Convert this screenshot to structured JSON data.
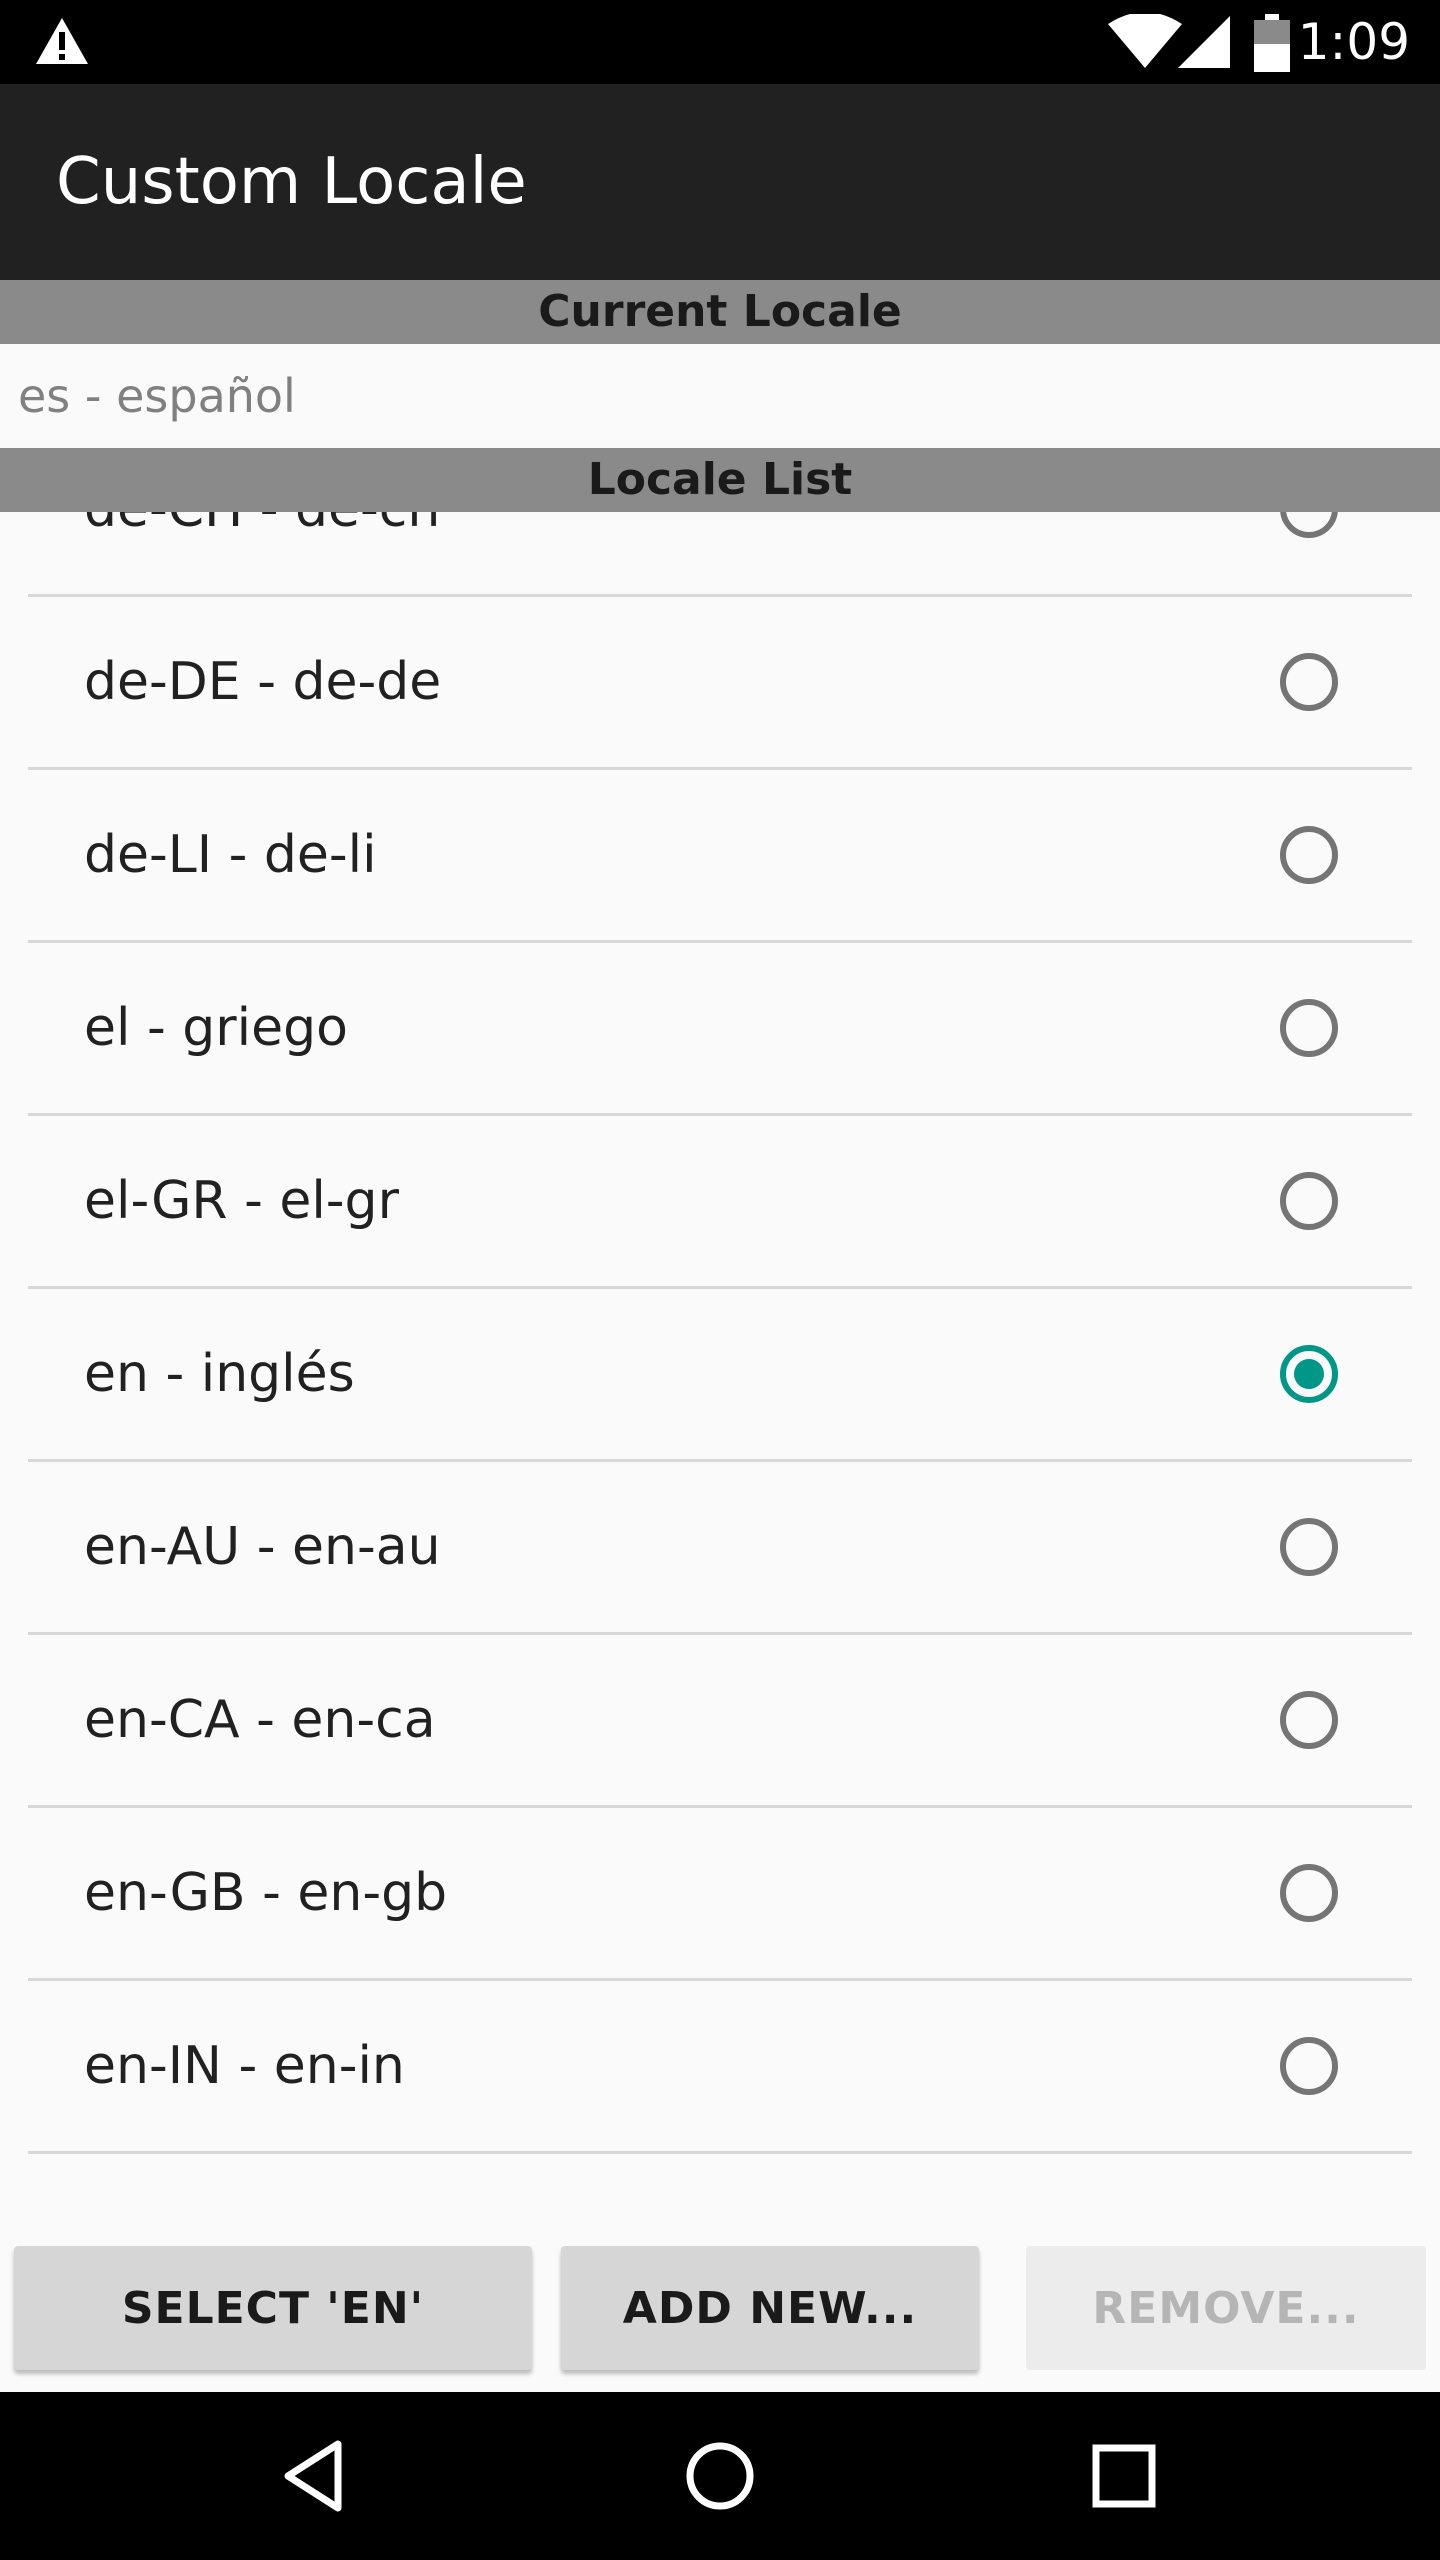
{
  "status_bar": {
    "time": "1:09",
    "icons": [
      "warning-icon",
      "wifi-icon",
      "signal-icon",
      "battery-icon"
    ]
  },
  "app_bar": {
    "title": "Custom Locale"
  },
  "current_locale": {
    "header": "Current Locale",
    "value": "es - español"
  },
  "locale_list": {
    "header": "Locale List",
    "items": [
      {
        "label": "de-CH - de-ch",
        "selected": false
      },
      {
        "label": "de-DE - de-de",
        "selected": false
      },
      {
        "label": "de-LI - de-li",
        "selected": false
      },
      {
        "label": "el - griego",
        "selected": false
      },
      {
        "label": "el-GR - el-gr",
        "selected": false
      },
      {
        "label": "en - inglés",
        "selected": true
      },
      {
        "label": "en-AU - en-au",
        "selected": false
      },
      {
        "label": "en-CA - en-ca",
        "selected": false
      },
      {
        "label": "en-GB - en-gb",
        "selected": false
      },
      {
        "label": "en-IN - en-in",
        "selected": false
      }
    ]
  },
  "buttons": {
    "select": "SELECT 'EN'",
    "add_new": "ADD NEW...",
    "remove": "REMOVE..."
  },
  "colors": {
    "accent": "#009688",
    "app_bar": "#212121",
    "section_header": "#8a8a8a"
  }
}
